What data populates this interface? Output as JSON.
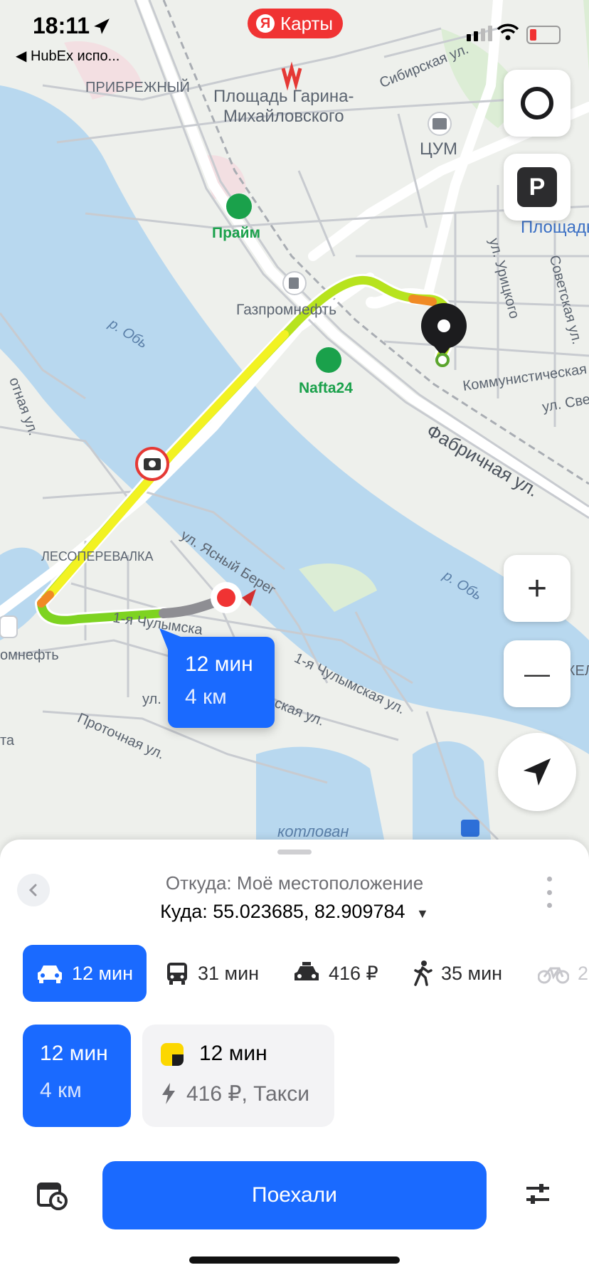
{
  "status_bar": {
    "time": "18:11",
    "back_app": "◀ HubEx  испо..."
  },
  "brand": {
    "label": "Карты",
    "logo_letter": "Я"
  },
  "map": {
    "labels": {
      "district_1": "ПРИБРЕЖНЫЙ",
      "metro": "Площадь Гарина-\nМихайловского",
      "tsum": "ЦУМ",
      "square_right": "Площадь",
      "prime": "Прайм",
      "gazprom": "Газпромнефть",
      "nafta": "Nafta24",
      "river_1": "р. Обь",
      "river_2": "р. Обь",
      "kommunisticheskaya": "Коммунистическая",
      "fabrichnaya": "Фабричная ул.",
      "sibirskaya": "Сибирская ул.",
      "uritskogo": "ул. Урицкого",
      "sovetskaya": "Советская ул.",
      "sver": "ул. Све",
      "lesoperevalka": "ЛЕСОПЕРЕВАЛКА",
      "yasny_bereg": "ул. Ясный Берег",
      "chulymskaya_1": "1-я Чулымска",
      "chulymskaya_2": "1-я Чулымская ул.",
      "chulymskaya_3": "ская ул.",
      "protochnaya": "Проточная ул.",
      "left_street": "отная ул.",
      "left_fuel": "омнефть",
      "left_ta": "та",
      "kotlovan": "котлован",
      "zhel": "ЖЕЛ",
      "ul_cut": "ул. "
    }
  },
  "controls": {
    "zoom_in": "+",
    "zoom_out": "—",
    "parking": "P"
  },
  "route_badge": {
    "time": "12 мин",
    "distance": "4 км"
  },
  "sheet": {
    "from": "Откуда: Моё местоположение",
    "to": "Куда: 55.023685, 82.909784",
    "to_arrow": "▼",
    "modes": [
      {
        "label": "12 мин",
        "icon": "car-icon"
      },
      {
        "label": "31 мин",
        "icon": "bus-icon"
      },
      {
        "label": "416 ₽",
        "icon": "taxi-icon"
      },
      {
        "label": "35 мин",
        "icon": "walk-icon"
      },
      {
        "label": "2",
        "icon": "bike-icon"
      }
    ],
    "route_card": {
      "time": "12 мин",
      "distance": "4 км"
    },
    "taxi_card": {
      "time": "12 мин",
      "price": "416 ₽, Такси"
    },
    "go_label": "Поехали"
  },
  "colors": {
    "accent": "#1a6aff",
    "brand_red": "#f03333",
    "water": "#b8d8ef",
    "route_green": "#7ed321",
    "route_yellow": "#f2f222"
  }
}
